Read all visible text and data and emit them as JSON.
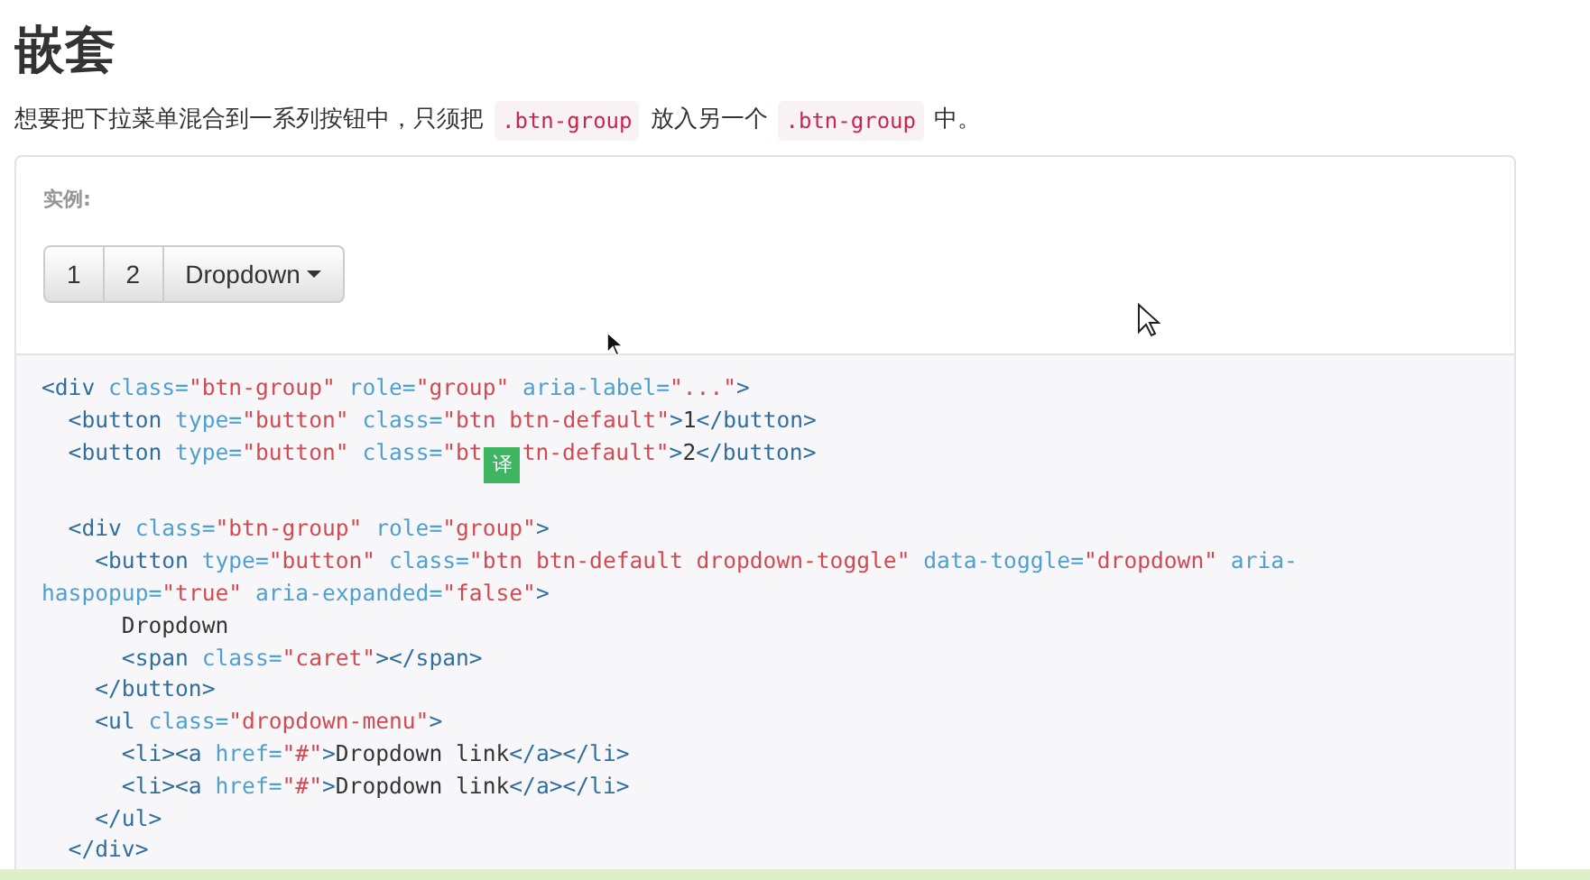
{
  "heading": "嵌套",
  "intro": [
    {
      "kind": "text",
      "text": "想要把下拉菜单混合到一系列按钮中，只须把"
    },
    {
      "kind": "code",
      "text": ".btn-group"
    },
    {
      "kind": "text",
      "text": "放入另一个"
    },
    {
      "kind": "code",
      "text": ".btn-group"
    },
    {
      "kind": "text",
      "text": "中。"
    }
  ],
  "example": {
    "label": "实例:",
    "buttons": [
      {
        "label": "1",
        "kind": "plain"
      },
      {
        "label": "2",
        "kind": "plain"
      },
      {
        "label": "Dropdown",
        "kind": "dropdown"
      }
    ]
  },
  "code_lines": [
    {
      "kind": "code",
      "tokens": [
        {
          "kind": "tag",
          "text": "<div"
        },
        {
          "kind": "attr",
          "text": " class="
        },
        {
          "kind": "str",
          "text": "\"btn-group\""
        },
        {
          "kind": "attr",
          "text": " role="
        },
        {
          "kind": "str",
          "text": "\"group\""
        },
        {
          "kind": "attr",
          "text": " aria-label="
        },
        {
          "kind": "str",
          "text": "\"...\""
        },
        {
          "kind": "tag",
          "text": ">"
        }
      ]
    },
    {
      "kind": "code",
      "tokens": [
        {
          "kind": "tag",
          "text": "  <button"
        },
        {
          "kind": "attr",
          "text": " type="
        },
        {
          "kind": "str",
          "text": "\"button\""
        },
        {
          "kind": "attr",
          "text": " class="
        },
        {
          "kind": "str",
          "text": "\"btn btn-default\""
        },
        {
          "kind": "tag",
          "text": ">"
        },
        {
          "kind": "plain",
          "text": "1"
        },
        {
          "kind": "tag",
          "text": "</button>"
        }
      ]
    },
    {
      "kind": "code",
      "tokens": [
        {
          "kind": "tag",
          "text": "  <button"
        },
        {
          "kind": "attr",
          "text": " type="
        },
        {
          "kind": "str",
          "text": "\"button\""
        },
        {
          "kind": "attr",
          "text": " class="
        },
        {
          "kind": "str",
          "text": "\"bt"
        },
        {
          "kind": "badge",
          "text": "译"
        },
        {
          "kind": "str",
          "text": "tn-default\""
        },
        {
          "kind": "tag",
          "text": ">"
        },
        {
          "kind": "plain",
          "text": "2"
        },
        {
          "kind": "tag",
          "text": "</button>"
        }
      ]
    },
    {
      "kind": "blank"
    },
    {
      "kind": "code",
      "tokens": [
        {
          "kind": "tag",
          "text": "  <div"
        },
        {
          "kind": "attr",
          "text": " class="
        },
        {
          "kind": "str",
          "text": "\"btn-group\""
        },
        {
          "kind": "attr",
          "text": " role="
        },
        {
          "kind": "str",
          "text": "\"group\""
        },
        {
          "kind": "tag",
          "text": ">"
        }
      ]
    },
    {
      "kind": "code",
      "tokens": [
        {
          "kind": "tag",
          "text": "    <button"
        },
        {
          "kind": "attr",
          "text": " type="
        },
        {
          "kind": "str",
          "text": "\"button\""
        },
        {
          "kind": "attr",
          "text": " class="
        },
        {
          "kind": "str",
          "text": "\"btn btn-default dropdown-toggle\""
        },
        {
          "kind": "attr",
          "text": " data-toggle="
        },
        {
          "kind": "str",
          "text": "\"dropdown\""
        },
        {
          "kind": "attr",
          "text": " aria-"
        }
      ]
    },
    {
      "kind": "code",
      "tokens": [
        {
          "kind": "attr",
          "text": "haspopup="
        },
        {
          "kind": "str",
          "text": "\"true\""
        },
        {
          "kind": "attr",
          "text": " aria-expanded="
        },
        {
          "kind": "str",
          "text": "\"false\""
        },
        {
          "kind": "tag",
          "text": ">"
        }
      ]
    },
    {
      "kind": "code",
      "tokens": [
        {
          "kind": "plain",
          "text": "      Dropdown"
        }
      ]
    },
    {
      "kind": "code",
      "tokens": [
        {
          "kind": "tag",
          "text": "      <span"
        },
        {
          "kind": "attr",
          "text": " class="
        },
        {
          "kind": "str",
          "text": "\"caret\""
        },
        {
          "kind": "tag",
          "text": "></span>"
        }
      ]
    },
    {
      "kind": "code",
      "tokens": [
        {
          "kind": "tag",
          "text": "    </button>"
        }
      ]
    },
    {
      "kind": "code",
      "tokens": [
        {
          "kind": "tag",
          "text": "    <ul"
        },
        {
          "kind": "attr",
          "text": " class="
        },
        {
          "kind": "str",
          "text": "\"dropdown-menu\""
        },
        {
          "kind": "tag",
          "text": ">"
        }
      ]
    },
    {
      "kind": "code",
      "tokens": [
        {
          "kind": "tag",
          "text": "      <li><a"
        },
        {
          "kind": "attr",
          "text": " href="
        },
        {
          "kind": "str",
          "text": "\"#\""
        },
        {
          "kind": "tag",
          "text": ">"
        },
        {
          "kind": "plain",
          "text": "Dropdown link"
        },
        {
          "kind": "tag",
          "text": "</a></li>"
        }
      ]
    },
    {
      "kind": "code",
      "tokens": [
        {
          "kind": "tag",
          "text": "      <li><a"
        },
        {
          "kind": "attr",
          "text": " href="
        },
        {
          "kind": "str",
          "text": "\"#\""
        },
        {
          "kind": "tag",
          "text": ">"
        },
        {
          "kind": "plain",
          "text": "Dropdown link"
        },
        {
          "kind": "tag",
          "text": "</a></li>"
        }
      ]
    },
    {
      "kind": "code",
      "tokens": [
        {
          "kind": "tag",
          "text": "    </ul>"
        }
      ]
    },
    {
      "kind": "code",
      "tokens": [
        {
          "kind": "tag",
          "text": "  </div>"
        }
      ]
    }
  ]
}
